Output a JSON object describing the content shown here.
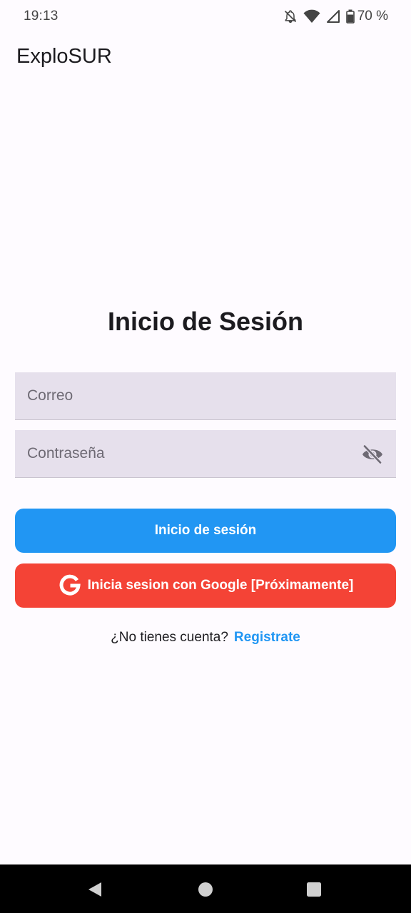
{
  "status_bar": {
    "time": "19:13",
    "battery_percent": "70 %",
    "icons": [
      "notifications-off-icon",
      "wifi-icon",
      "signal-icon",
      "battery-icon"
    ]
  },
  "app_bar": {
    "title": "ExploSUR"
  },
  "login": {
    "heading": "Inicio de Sesión",
    "email_placeholder": "Correo",
    "email_value": "",
    "password_placeholder": "Contraseña",
    "password_value": "",
    "password_toggle_icon": "visibility-off-icon",
    "login_button_label": "Inicio de sesión",
    "google_button_label": "Inicia sesion con Google [Próximamente]",
    "google_icon": "google-icon",
    "register_question": "¿No tienes cuenta?",
    "register_link": "Registrate"
  },
  "colors": {
    "background": "#fefbff",
    "field_fill": "#e6e0ec",
    "primary_button": "#2196f3",
    "google_button": "#f44336",
    "link": "#2196f3",
    "nav_bar": "#000000"
  },
  "nav_bar": {
    "buttons": [
      "back-icon",
      "home-icon",
      "recents-icon"
    ]
  }
}
